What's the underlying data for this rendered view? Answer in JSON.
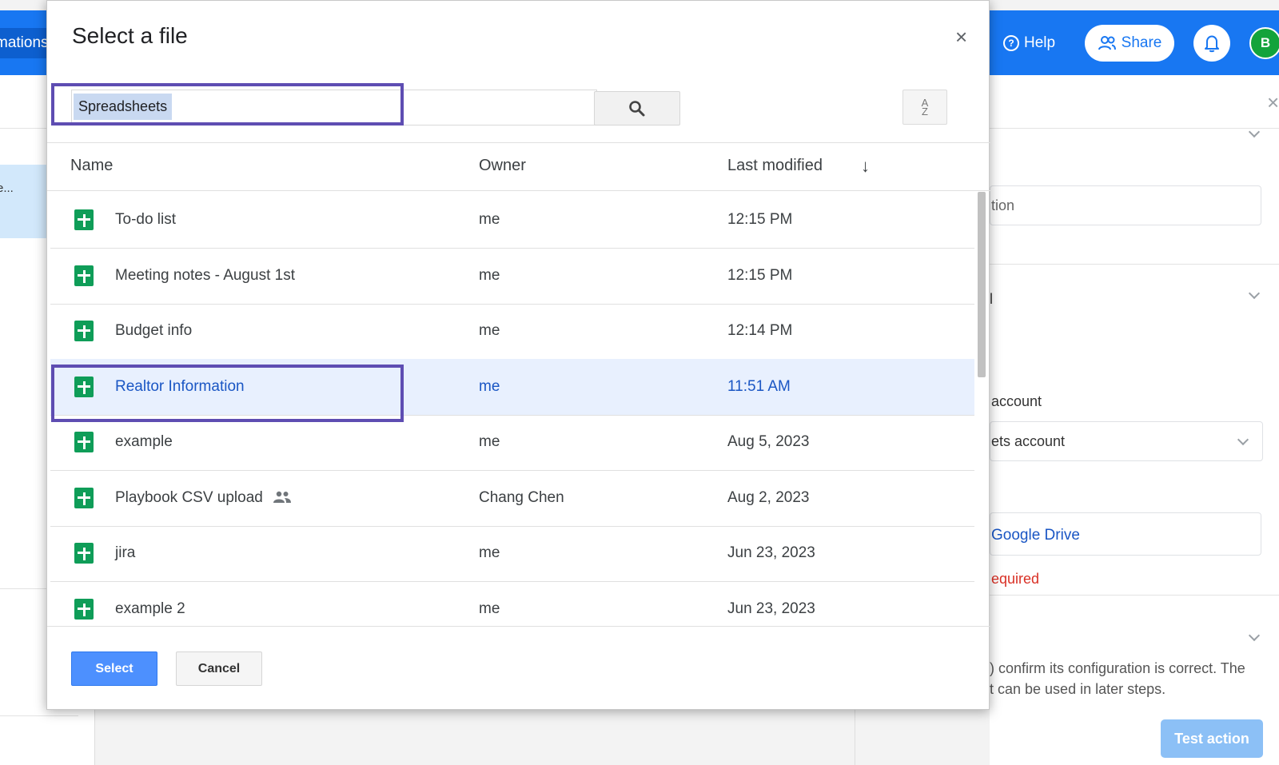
{
  "background": {
    "topbar": {
      "left_tab": "mations",
      "help_label": "Help",
      "share_label": "Share",
      "avatar_initial": "B"
    },
    "left_panel": {
      "highlight_text": "e..."
    },
    "right_panel": {
      "field1_text": "tion",
      "section_label_i": "l",
      "account_label": "account",
      "account_select": "ets account",
      "drive_label": "Google Drive",
      "required_text": "equired",
      "desc_line1": ") confirm its configuration is correct. The",
      "desc_line2": "t can be used in later steps.",
      "test_action": "Test action"
    },
    "colors": {
      "brand": "#1877f2",
      "success": "#13a33b",
      "error": "#d93025"
    }
  },
  "dialog": {
    "title": "Select a file",
    "close_icon": "close-icon",
    "search": {
      "value": "Spreadsheets",
      "placeholder": ""
    },
    "columns": {
      "name": "Name",
      "owner": "Owner",
      "modified": "Last modified"
    },
    "sort_button_label": "A Z",
    "files": [
      {
        "name": "To-do list",
        "owner": "me",
        "modified": "12:15 PM",
        "shared": false,
        "selected": false
      },
      {
        "name": "Meeting notes - August 1st",
        "owner": "me",
        "modified": "12:15 PM",
        "shared": false,
        "selected": false
      },
      {
        "name": "Budget info",
        "owner": "me",
        "modified": "12:14 PM",
        "shared": false,
        "selected": false
      },
      {
        "name": "Realtor Information",
        "owner": "me",
        "modified": "11:51 AM",
        "shared": false,
        "selected": true
      },
      {
        "name": "example",
        "owner": "me",
        "modified": "Aug 5, 2023",
        "shared": false,
        "selected": false
      },
      {
        "name": "Playbook CSV upload",
        "owner": "Chang Chen",
        "modified": "Aug 2, 2023",
        "shared": true,
        "selected": false
      },
      {
        "name": "jira",
        "owner": "me",
        "modified": "Jun 23, 2023",
        "shared": false,
        "selected": false
      },
      {
        "name": "example 2",
        "owner": "me",
        "modified": "Jun 23, 2023",
        "shared": false,
        "selected": false
      }
    ],
    "select_label": "Select",
    "cancel_label": "Cancel",
    "colors": {
      "sheet_green": "#0f9d58",
      "selected_bg": "#e8f0fe",
      "primary_button": "#4d90fe",
      "highlight_border": "#5e4db2"
    }
  }
}
